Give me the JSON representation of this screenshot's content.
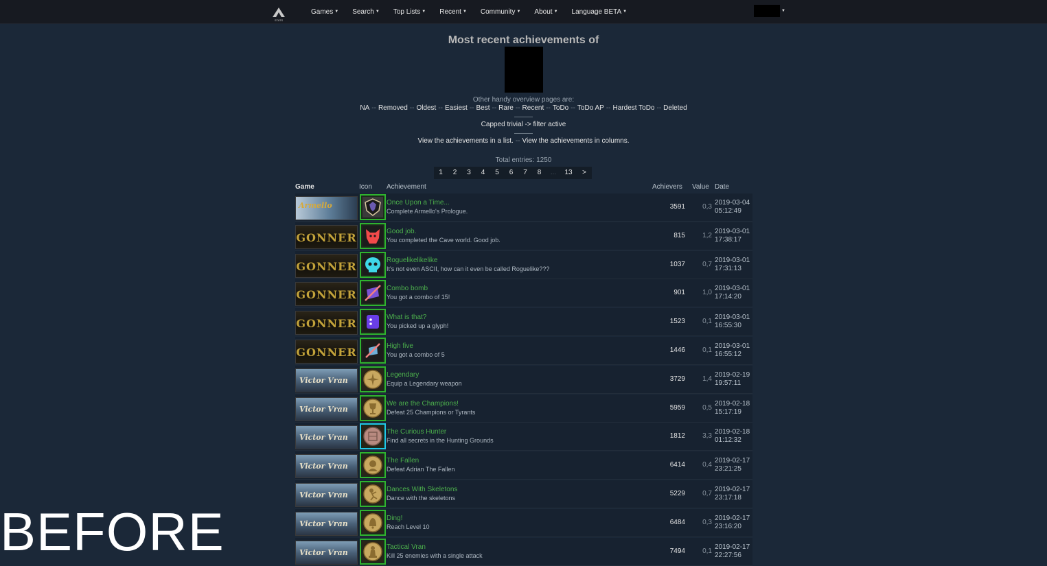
{
  "nav": {
    "items": [
      "Games",
      "Search",
      "Top Lists",
      "Recent",
      "Community",
      "About",
      "Language BETA"
    ],
    "logo_text": "STATS"
  },
  "heading": "Most recent achievements of",
  "overview": {
    "label": "Other handy overview pages are:",
    "links": [
      "NA",
      "Removed",
      "Oldest",
      "Easiest",
      "Best",
      "Rare",
      "Recent",
      "ToDo",
      "ToDo AP",
      "Hardest ToDo",
      "Deleted"
    ]
  },
  "filter_text": "Capped trivial -> filter active",
  "view": {
    "list": "View the achievements in a list.",
    "columns": "View the achievements in columns."
  },
  "total_entries": "Total entries: 1250",
  "pagination": [
    "1",
    "2",
    "3",
    "4",
    "5",
    "6",
    "7",
    "8",
    "...",
    "13",
    ">"
  ],
  "table": {
    "headers": {
      "game": "Game",
      "icon": "Icon",
      "achievement": "Achievement",
      "achievers": "Achievers",
      "value": "Value",
      "date": "Date"
    },
    "rows": [
      {
        "game_banner": "Armello",
        "icon": "shield-crest-icon",
        "name": "Once Upon a Time...",
        "desc": "Complete Armello's Prologue.",
        "achievers": "3591",
        "value": "0,3",
        "date": "2019-03-04",
        "time": "05:12:49"
      },
      {
        "game_banner": "GONNER",
        "icon": "red-demon-icon",
        "name": "Good job.",
        "desc": "You completed the Cave world. Good job.",
        "achievers": "815",
        "value": "1,2",
        "date": "2019-03-01",
        "time": "17:38:17"
      },
      {
        "game_banner": "GONNER",
        "icon": "cyan-skull-icon",
        "name": "Roguelikelikelike",
        "desc": "It's not even ASCII, how can it even be called Roguelike???",
        "achievers": "1037",
        "value": "0,7",
        "date": "2019-03-01",
        "time": "17:31:13"
      },
      {
        "game_banner": "GONNER",
        "icon": "combo-slash-icon",
        "name": "Combo bomb",
        "desc": "You got a combo of 15!",
        "achievers": "901",
        "value": "1,0",
        "date": "2019-03-01",
        "time": "17:14:20"
      },
      {
        "game_banner": "GONNER",
        "icon": "glyph-icon",
        "name": "What is that?",
        "desc": "You picked up a glyph!",
        "achievers": "1523",
        "value": "0,1",
        "date": "2019-03-01",
        "time": "16:55:30"
      },
      {
        "game_banner": "GONNER",
        "icon": "combo-slash-small-icon",
        "name": "High five",
        "desc": "You got a combo of 5",
        "achievers": "1446",
        "value": "0,1",
        "date": "2019-03-01",
        "time": "16:55:12"
      },
      {
        "game_banner": "Victor Vran",
        "icon": "legendary-coin-icon",
        "name": "Legendary",
        "desc": "Equip a Legendary weapon",
        "achievers": "3729",
        "value": "1,4",
        "date": "2019-02-19",
        "time": "19:57:11"
      },
      {
        "game_banner": "Victor Vran",
        "icon": "trophy-coin-icon",
        "name": "We are the Champions!",
        "desc": "Defeat 25 Champions or Tyrants",
        "achievers": "5959",
        "value": "0,5",
        "date": "2019-02-18",
        "time": "15:17:19"
      },
      {
        "game_banner": "Victor Vran",
        "icon": "hunter-coin-icon",
        "name": "The Curious Hunter",
        "desc": "Find all secrets in the Hunting Grounds",
        "achievers": "1812",
        "value": "3,3",
        "date": "2019-02-18",
        "time": "01:12:32"
      },
      {
        "game_banner": "Victor Vran",
        "icon": "fallen-coin-icon",
        "name": "The Fallen",
        "desc": "Defeat Adrian The Fallen",
        "achievers": "6414",
        "value": "0,4",
        "date": "2019-02-17",
        "time": "23:21:25"
      },
      {
        "game_banner": "Victor Vran",
        "icon": "skeleton-coin-icon",
        "name": "Dances With Skeletons",
        "desc": "Dance with the skeletons",
        "achievers": "5229",
        "value": "0,7",
        "date": "2019-02-17",
        "time": "23:17:18"
      },
      {
        "game_banner": "Victor Vran",
        "icon": "bell-coin-icon",
        "name": "Ding!",
        "desc": "Reach Level 10",
        "achievers": "6484",
        "value": "0,3",
        "date": "2019-02-17",
        "time": "23:16:20"
      },
      {
        "game_banner": "Victor Vran",
        "icon": "pawn-coin-icon",
        "name": "Tactical Vran",
        "desc": "Kill 25 enemies with a single attack",
        "achievers": "7494",
        "value": "0,1",
        "date": "2019-02-17",
        "time": "22:27:56"
      }
    ]
  },
  "watermark": "BEFORE",
  "colors": {
    "background": "#1b2838",
    "topbar": "#171a21",
    "achievement_name": "#4cb04c",
    "icon_border": "#2fb32f",
    "rare_icon_border": "#20c8e8"
  }
}
